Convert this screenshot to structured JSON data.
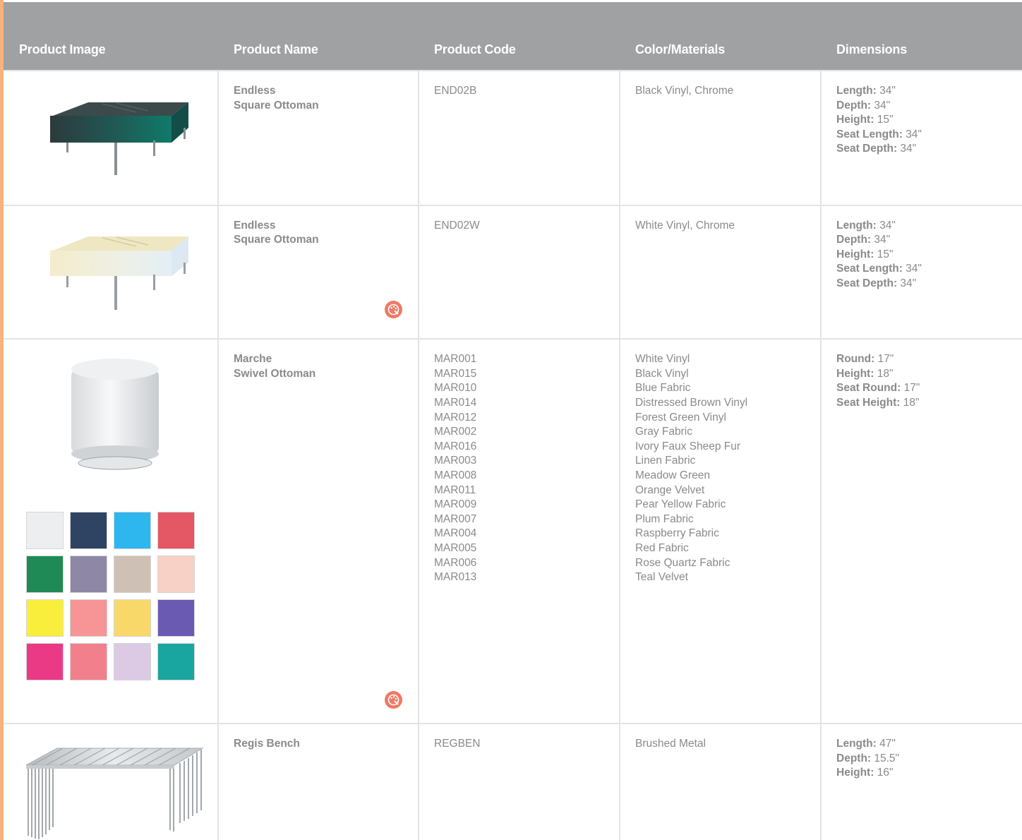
{
  "headers": {
    "image": "Product Image",
    "name": "Product Name",
    "code": "Product Code",
    "materials": "Color/Materials",
    "dimensions": "Dimensions"
  },
  "rows": [
    {
      "image_icon": "black-square-ottoman-image",
      "name_line1": "Endless",
      "name_line2": "Square Ottoman",
      "codes": [
        "END02B"
      ],
      "materials": [
        "Black Vinyl, Chrome"
      ],
      "dimensions": [
        {
          "label": "Length:",
          "value": " 34\""
        },
        {
          "label": "Depth:",
          "value": " 34\""
        },
        {
          "label": "Height:",
          "value": " 15\""
        },
        {
          "label": "Seat Length:",
          "value": " 34\""
        },
        {
          "label": "Seat Depth:",
          "value": " 34\""
        }
      ]
    },
    {
      "image_icon": "white-square-ottoman-image",
      "name_line1": "Endless",
      "name_line2": "Square Ottoman",
      "codes": [
        "END02W"
      ],
      "materials": [
        "White Vinyl, Chrome"
      ],
      "dimensions": [
        {
          "label": "Length:",
          "value": " 34\""
        },
        {
          "label": "Depth:",
          "value": " 34\""
        },
        {
          "label": "Height:",
          "value": " 15\""
        },
        {
          "label": "Seat Length:",
          "value": " 34\""
        },
        {
          "label": "Seat Depth:",
          "value": " 34\""
        }
      ]
    },
    {
      "image_icon": "round-swivel-ottoman-image",
      "name_line1": "Marche",
      "name_line2": "Swivel Ottoman",
      "codes": [
        "MAR001",
        "MAR015",
        "MAR010",
        "MAR014",
        "MAR012",
        "MAR002",
        "MAR016",
        "MAR003",
        "MAR008",
        "MAR011",
        "MAR009",
        "MAR007",
        "MAR004",
        "MAR005",
        "MAR006",
        "MAR013"
      ],
      "materials": [
        "White Vinyl",
        "Black Vinyl",
        "Blue Fabric",
        "Distressed Brown Vinyl",
        "Forest Green Vinyl",
        "Gray Fabric",
        "Ivory Faux Sheep Fur",
        "Linen Fabric",
        "Meadow Green",
        "Orange Velvet",
        "Pear Yellow Fabric",
        "Plum Fabric",
        "Raspberry Fabric",
        "Red Fabric",
        "Rose Quartz Fabric",
        "Teal Velvet"
      ],
      "dimensions": [
        {
          "label": "Round:",
          "value": " 17\""
        },
        {
          "label": "Height:",
          "value": " 18\""
        },
        {
          "label": "Seat Round:",
          "value": " 17\""
        },
        {
          "label": "Seat Height:",
          "value": " 18\""
        }
      ],
      "swatch_colors": [
        "#eceef0",
        "#2f4463",
        "#2eb6ee",
        "#e45764",
        "#1f8a55",
        "#8e88a6",
        "#cfc0b6",
        "#f7d0c6",
        "#f9ee3c",
        "#f69496",
        "#f9d86a",
        "#6a5ab2",
        "#ea3a86",
        "#f1808c",
        "#dcc9e4",
        "#1aa6a0"
      ]
    },
    {
      "image_icon": "metal-bench-image",
      "name_line1": "Regis Bench",
      "name_line2": "",
      "codes": [
        "REGBEN"
      ],
      "materials": [
        "Brushed Metal"
      ],
      "dimensions": [
        {
          "label": "Length:",
          "value": " 47\""
        },
        {
          "label": "Depth:",
          "value": " 15.5\""
        },
        {
          "label": "Height:",
          "value": " 16\""
        }
      ]
    }
  ],
  "colors": {
    "header_bg": "#a0a1a3",
    "accent": "#f7b27e",
    "swatch_badge": "#ee7a66",
    "text": "#8a8a8a",
    "grid": "#e3e3e3"
  },
  "icons": {
    "swatch_badge": "color-palette-icon"
  }
}
